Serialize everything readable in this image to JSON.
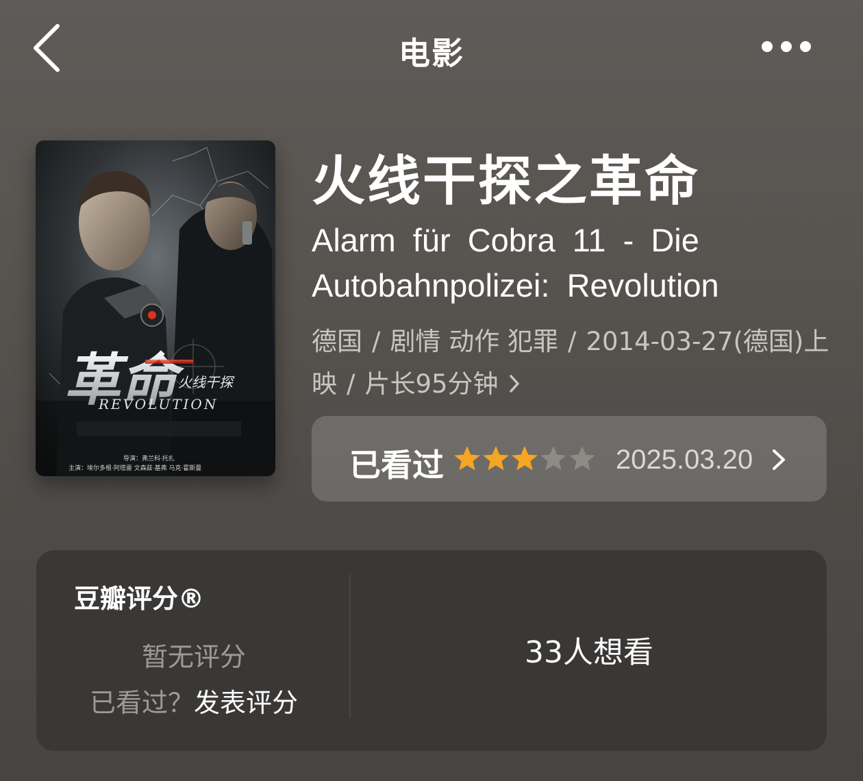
{
  "nav": {
    "title": "电影",
    "back_icon": "chevron-left-icon",
    "more_icon": "more-horizontal-icon"
  },
  "movie": {
    "title_cn": "火线干探之革命",
    "title_original": "Alarm für Cobra 11 - Die Autobahnpolizei: Revolution",
    "country": "德国",
    "separator": "/",
    "genres": "剧情  动作  犯罪",
    "release": "2014-03-27(德国)上映",
    "runtime": "片长95分钟",
    "poster": {
      "title_cn_large": "革命",
      "title_cn_small": "火线干探",
      "title_en": "REVOLUTION",
      "credits_director": "导演：弗兰科·托扎",
      "credits_cast": "主演：埃尔多根·阿塔雷 文森兹·基弗 马克·霍斯曼"
    }
  },
  "watched": {
    "label": "已看过",
    "rating": 3,
    "max_rating": 5,
    "date": "2025.03.20",
    "star_on_color": "#f5a623",
    "star_off_color": "#8e8a86"
  },
  "douban": {
    "title": "豆瓣评分®",
    "no_rating": "暂无评分",
    "watched_question": "已看过？",
    "rate_action": "发表评分",
    "want_count": "33人想看"
  }
}
